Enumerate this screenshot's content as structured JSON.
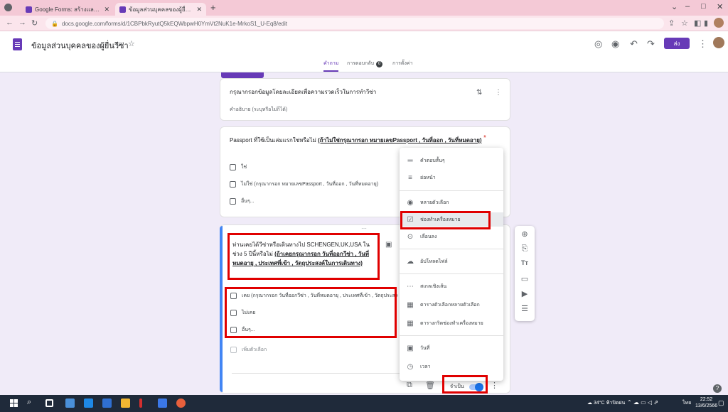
{
  "browser": {
    "tabs": [
      {
        "label": "Google Forms: สร้างและวิเคราะห์แบบสำรวจ",
        "favicon_color": "#673ab7"
      },
      {
        "label": "ข้อมูลส่วนบุคคลของผู้ยื่นวีซ่า - Google Forms",
        "favicon_color": "#673ab7"
      }
    ],
    "url": "docs.google.com/forms/d/1CBPbkRyutQ5kEQWbpwH0YmVt2NuK1e-MrkoS1_U-Eq8/edit",
    "window_buttons": {
      "minimize": "–",
      "maximize": "□",
      "close": "✕"
    }
  },
  "header": {
    "form_title": "ข้อมูลส่วนบุคคลของผู้ยื่นวีซ่า",
    "send_label": "ส่ง",
    "tabs": {
      "questions": "คำถาม",
      "responses": "การตอบกลับ",
      "responses_count": "0",
      "settings": "การตั้งค่า"
    }
  },
  "description_card": {
    "title": "กรุณากรอกข้อมูลโดยละเอียดเพื่อความรวดเร็วในการทำวีซ่า",
    "subtitle": "คำอธิบาย (ระบุหรือไม่ก็ได้)"
  },
  "question1": {
    "title_plain": "Passport ที่ใช้เป็นเล่มแรกใช่หรือไม่ ",
    "title_underlined": "(ถ้าไม่ใช่กรุณากรอก หมายเลขPassport , วันที่ออก , วันที่หมดอายุ)",
    "options": [
      "ใช่",
      "ไม่ใช่ (กรุณากรอก หมายเลขPassport , วันที่ออก , วันที่หมดอายุ)",
      "อื่นๆ..."
    ]
  },
  "question2": {
    "title_plain": "ท่านเคยได้วีซ่าหรือเดินทางไป SCHENGEN,UK,USA ในช่วง 5 ปีนี้หรือไม่ ",
    "title_underlined": "(ถ้าเคยกรุณากรอก วันที่ออกวีซ่า , วันที่หมดอายุ , ประเทศที่เข้า , วัตถุประสงค์ในการเดินทาง)",
    "options": [
      "เคย (กรุณากรอก วันที่ออกวีซ่า , วันที่หมดอายุ , ประเทศที่เข้า , วัตถุประสงค์",
      "ไม่เคย",
      "อื่นๆ...",
      "เพิ่มตัวเลือก"
    ],
    "required_label": "จำเป็น",
    "required_on": true
  },
  "type_menu": {
    "items": [
      {
        "label": "คำตอบสั้นๆ",
        "icon": "short-answer-icon",
        "glyph": "═"
      },
      {
        "label": "ย่อหน้า",
        "icon": "paragraph-icon",
        "glyph": "≡"
      },
      {
        "label": "หลายตัวเลือก",
        "icon": "radio-icon",
        "glyph": "◉"
      },
      {
        "label": "ช่องทำเครื่องหมาย",
        "icon": "checkbox-icon",
        "glyph": "☑"
      },
      {
        "label": "เลื่อนลง",
        "icon": "dropdown-icon",
        "glyph": "⊙"
      },
      {
        "label": "อัปโหลดไฟล์",
        "icon": "upload-icon",
        "glyph": "☁"
      },
      {
        "label": "สเกลเชิงเส้น",
        "icon": "linear-scale-icon",
        "glyph": "⋯"
      },
      {
        "label": "ตารางตัวเลือกหลายตัวเลือก",
        "icon": "grid-icon",
        "glyph": "▦"
      },
      {
        "label": "ตารางกริดช่องทำเครื่องหมาย",
        "icon": "checkbox-grid-icon",
        "glyph": "▦"
      },
      {
        "label": "วันที่",
        "icon": "calendar-icon",
        "glyph": "▣"
      },
      {
        "label": "เวลา",
        "icon": "clock-icon",
        "glyph": "◷"
      }
    ],
    "selected_index": 3
  },
  "side_toolbar": {
    "icons": [
      {
        "name": "add-question-icon",
        "glyph": "⊕"
      },
      {
        "name": "import-questions-icon",
        "glyph": "⎘"
      },
      {
        "name": "add-title-icon",
        "glyph": "Tт"
      },
      {
        "name": "add-image-icon",
        "glyph": "▭"
      },
      {
        "name": "add-video-icon",
        "glyph": "▶"
      },
      {
        "name": "add-section-icon",
        "glyph": "☰"
      }
    ]
  },
  "taskbar": {
    "weather": "34°C ฟ้าปิดฝน",
    "lang": "ไทย",
    "time": "22:52",
    "date": "13/6/2566"
  },
  "colors": {
    "accent": "#673ab7",
    "highlight_red": "#e00000",
    "toggle_blue": "#1a73e8"
  }
}
